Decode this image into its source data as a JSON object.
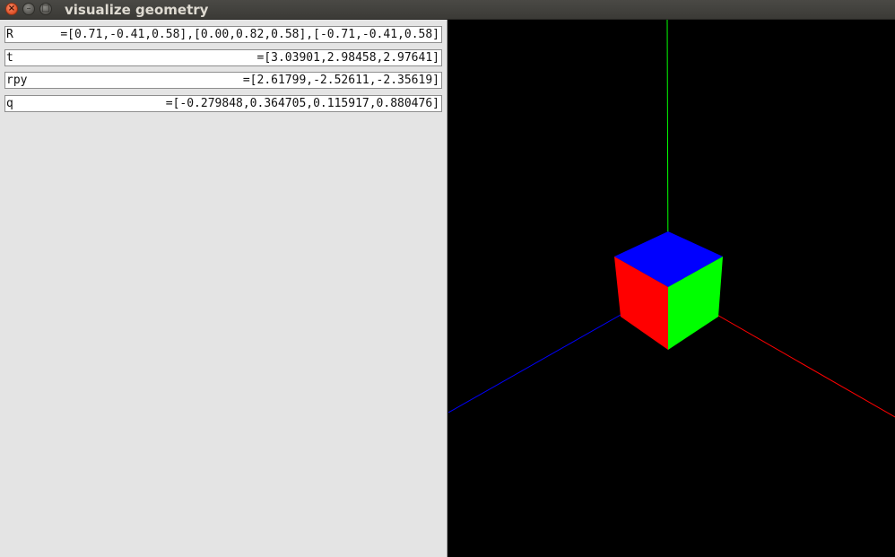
{
  "window": {
    "title": "visualize geometry",
    "buttons": {
      "close_glyph": "×",
      "minimize_glyph": "–",
      "maximize_glyph": "□"
    }
  },
  "fields": {
    "R": {
      "label": "R",
      "value": "=[0.71,-0.41,0.58],[0.00,0.82,0.58],[-0.71,-0.41,0.58]"
    },
    "t": {
      "label": "t",
      "value": "=[3.03901,2.98458,2.97641]"
    },
    "rpy": {
      "label": "rpy",
      "value": "=[2.61799,-2.52611,-2.35619]"
    },
    "q": {
      "label": "q",
      "value": "=[-0.279848,0.364705,0.115917,0.880476]"
    }
  },
  "viewport": {
    "background": "#000000",
    "axis_colors": {
      "x": "#ff0000",
      "y": "#00ff00",
      "z": "#0000ff"
    },
    "cube_face_colors": {
      "top": "#0000ff",
      "left": "#ff0000",
      "right": "#00ff00"
    }
  }
}
